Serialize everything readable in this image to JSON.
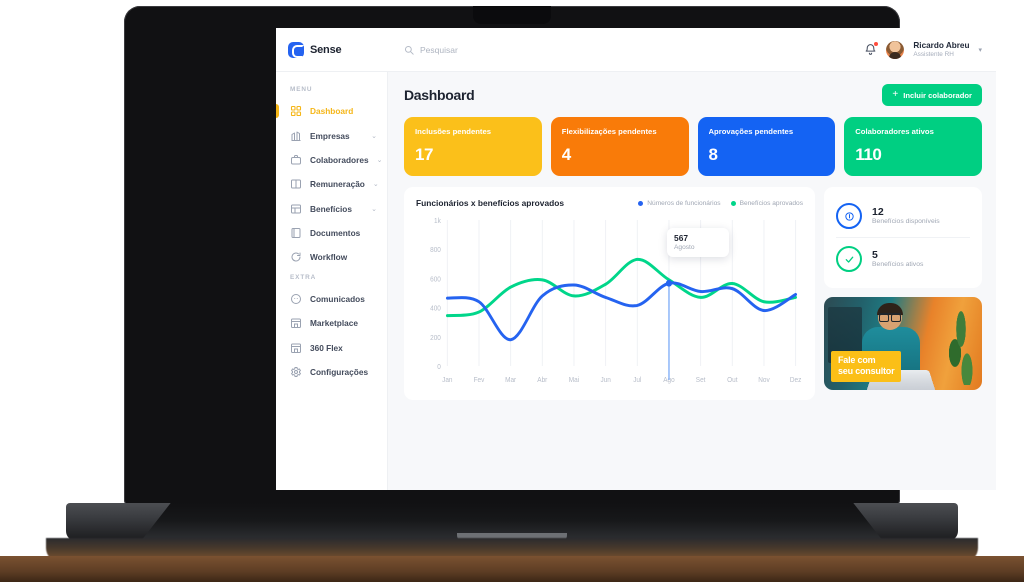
{
  "brand": {
    "name": "Sense",
    "logo_icon": "sense-logo-icon"
  },
  "topbar": {
    "search_placeholder": "Pesquisar",
    "search_icon": "search-icon",
    "bell_icon": "notification-bell-icon",
    "user_name": "Ricardo Abreu",
    "user_role": "Assistente RH",
    "caret": "▾"
  },
  "sidebar": {
    "section_menu": "MENU",
    "section_extra": "EXTRA",
    "menu_items": [
      {
        "label": "Dashboard",
        "icon": "grid-dashboard-icon",
        "active": true,
        "expandable": false
      },
      {
        "label": "Empresas",
        "icon": "building-icon",
        "active": false,
        "expandable": true
      },
      {
        "label": "Colaboradores",
        "icon": "briefcase-icon",
        "active": false,
        "expandable": true
      },
      {
        "label": "Remuneração",
        "icon": "book-icon",
        "active": false,
        "expandable": true
      },
      {
        "label": "Benefícios",
        "icon": "table-icon",
        "active": false,
        "expandable": true
      },
      {
        "label": "Documentos",
        "icon": "document-icon",
        "active": false,
        "expandable": false
      },
      {
        "label": "Workflow",
        "icon": "workflow-arrow-icon",
        "active": false,
        "expandable": false
      }
    ],
    "extra_items": [
      {
        "label": "Comunicados",
        "icon": "megaphone-circle-icon",
        "active": false,
        "expandable": false
      },
      {
        "label": "Marketplace",
        "icon": "store-icon",
        "active": false,
        "expandable": false
      },
      {
        "label": "360 Flex",
        "icon": "flex-icon",
        "active": false,
        "expandable": false
      },
      {
        "label": "Configurações",
        "icon": "gear-icon",
        "active": false,
        "expandable": false
      }
    ],
    "chevron": "⌄"
  },
  "main": {
    "page_title": "Dashboard",
    "add_button_label": "Incluir colaborador",
    "add_button_icon": "plus-icon",
    "add_button_color": "#00cf82"
  },
  "stat_cards": [
    {
      "label": "Inclusões pendentes",
      "value": "17",
      "color": "#fbc01a"
    },
    {
      "label": "Flexibilizações pendentes",
      "value": "4",
      "color": "#f97b09"
    },
    {
      "label": "Aprovações pendentes",
      "value": "8",
      "color": "#1463f3"
    },
    {
      "label": "Colaboradores ativos",
      "value": "110",
      "color": "#00cf82"
    }
  ],
  "chart_panel": {
    "title": "Funcionários x benefícios aprovados",
    "legend": [
      {
        "label": "Números de funcionários",
        "color": "#2563f0"
      },
      {
        "label": "Benefícios aprovados",
        "color": "#00d68a"
      }
    ],
    "tooltip": {
      "value": "567",
      "label": "Agosto"
    }
  },
  "chart_data": {
    "type": "line",
    "title": "Funcionários x benefícios aprovados",
    "xlabel": "",
    "ylabel": "",
    "categories": [
      "Jan",
      "Fev",
      "Mar",
      "Abr",
      "Mai",
      "Jun",
      "Jul",
      "Ago",
      "Set",
      "Out",
      "Nov",
      "Dez"
    ],
    "ylim": [
      0,
      1000
    ],
    "ytick_labels": [
      "0",
      "200",
      "400",
      "600",
      "800",
      "1k"
    ],
    "yticks": [
      0,
      200,
      400,
      600,
      800,
      1000
    ],
    "grid": "vertical",
    "legend_position": "top-right",
    "smooth": true,
    "series": [
      {
        "name": "Números de funcionários",
        "color": "#2563f0",
        "values": [
          465,
          440,
          180,
          480,
          555,
          470,
          415,
          567,
          510,
          530,
          380,
          490
        ]
      },
      {
        "name": "Benefícios aprovados",
        "color": "#00d68a",
        "values": [
          345,
          370,
          540,
          590,
          480,
          560,
          730,
          590,
          470,
          565,
          440,
          470
        ]
      }
    ],
    "annotations": [
      {
        "series": "Números de funcionários",
        "category": "Ago",
        "value": 567,
        "label": "Agosto",
        "marker": true,
        "vertical_line": true
      }
    ]
  },
  "side_stats": [
    {
      "value": "12",
      "label": "Benefícios disponíveis",
      "icon": "info-circle-icon",
      "color": "#1463f3"
    },
    {
      "value": "5",
      "label": "Benefícios ativos",
      "icon": "check-circle-icon",
      "color": "#00cf82"
    }
  ],
  "promo": {
    "line1": "Fale com",
    "line2": "seu consultor",
    "tag_color": "#fbbf17",
    "image_alt": "consultant-photo"
  }
}
